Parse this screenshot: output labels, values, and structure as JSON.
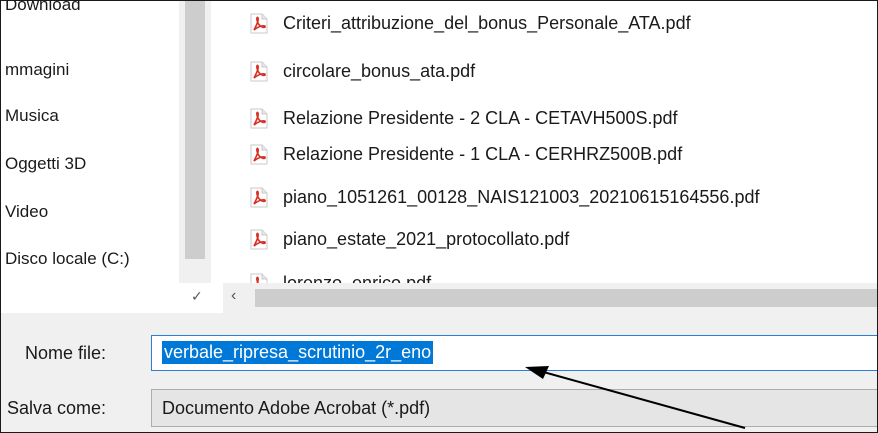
{
  "navigation": {
    "items": [
      {
        "label": "Download"
      },
      {
        "label": "mmagini"
      },
      {
        "label": "Musica"
      },
      {
        "label": "Oggetti 3D"
      },
      {
        "label": "Video"
      },
      {
        "label": "Disco locale (C:)"
      }
    ]
  },
  "files": [
    {
      "name": "Criteri_attribuzione_del_bonus_Personale_ATA.pdf",
      "icon": "pdf-file-icon"
    },
    {
      "name": "circolare_bonus_ata.pdf",
      "icon": "pdf-file-icon"
    },
    {
      "name": "Relazione Presidente - 2 CLA - CETAVH500S.pdf",
      "icon": "pdf-file-icon"
    },
    {
      "name": "Relazione Presidente - 1 CLA - CERHRZ500B.pdf",
      "icon": "pdf-file-icon"
    },
    {
      "name": "piano_1051261_00128_NAIS121003_20210615164556.pdf",
      "icon": "pdf-file-icon"
    },
    {
      "name": "piano_estate_2021_protocollato.pdf",
      "icon": "pdf-file-icon"
    },
    {
      "name": "lorenzo_enrico.pdf",
      "icon": "pdf-file-icon"
    }
  ],
  "form": {
    "filename_label": "Nome file:",
    "filename_value": "verbale_ripresa_scrutinio_2r_eno",
    "saveas_label": "Salva come:",
    "saveas_value": "Documento Adobe Acrobat (*.pdf)"
  },
  "colors": {
    "selection": "#0078d7",
    "pdf_red": "#d93025",
    "panel_bg": "#f0f0f0"
  }
}
